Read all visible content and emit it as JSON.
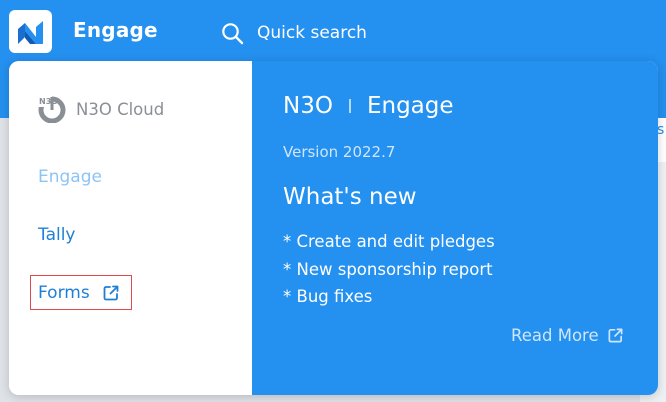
{
  "topbar": {
    "app_title": "Engage",
    "logo_icon": "n3o-logo-icon",
    "search_icon": "search-icon",
    "search_placeholder": "Quick search",
    "color": "#2490ef"
  },
  "background": {
    "partial_text": "s"
  },
  "switcher": {
    "cloud_label": "N3O Cloud",
    "cloud_icon": "n3o-cloud-icon",
    "nav": [
      {
        "label": "Engage",
        "state": "current"
      },
      {
        "label": "Tally",
        "state": "link"
      },
      {
        "label": "Forms",
        "state": "external-link",
        "icon": "external-link-icon"
      }
    ],
    "info": {
      "brand": "N3O",
      "product": "Engage",
      "version": "Version 2022.7",
      "whats_new_title": "What's new",
      "features": [
        "* Create and edit pledges",
        "* New sponsorship report",
        "* Bug fixes"
      ],
      "read_more_label": "Read More",
      "read_more_icon": "external-link-icon"
    }
  },
  "colors": {
    "accent": "#2490ef",
    "link": "#1f7fd6",
    "current": "#8cc4f5",
    "highlight_border": "#e04a4a"
  }
}
